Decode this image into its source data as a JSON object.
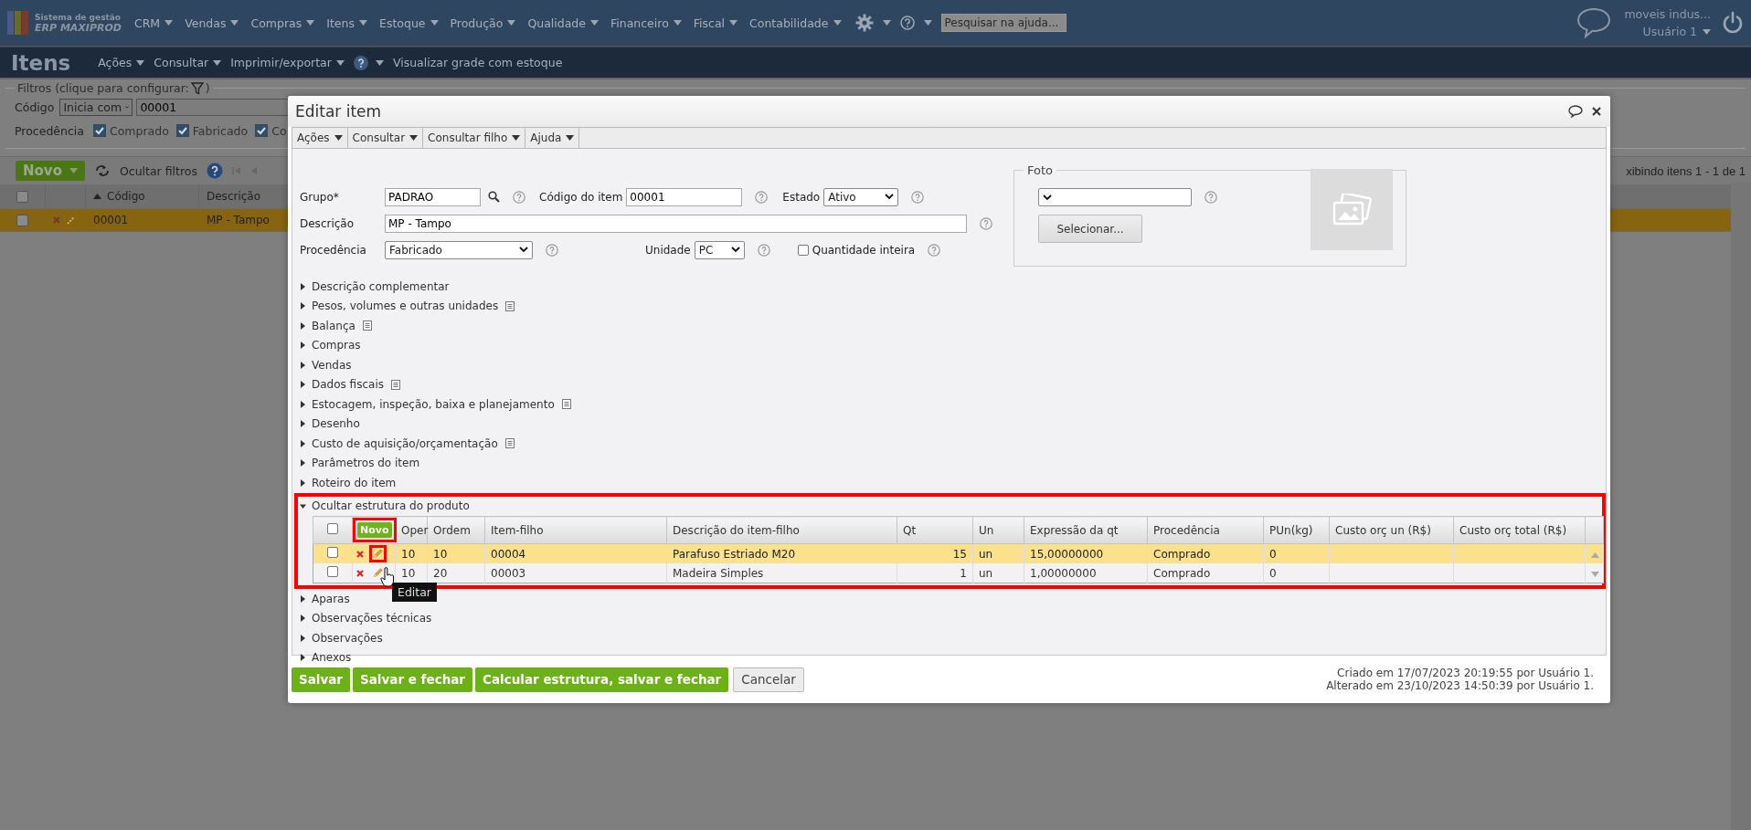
{
  "top_bar": {
    "brand": [
      "Sistema de gestão",
      "ERP MAXIPROD"
    ],
    "menu": [
      "CRM",
      "Vendas",
      "Compras",
      "Itens",
      "Estoque",
      "Produção",
      "Qualidade",
      "Financeiro",
      "Fiscal",
      "Contabilidade"
    ],
    "help_search": {
      "placeholder": "Pesquisar na ajuda..."
    },
    "account": {
      "company": "moveis indus...",
      "user": "Usuário 1"
    }
  },
  "page_header": {
    "title": "Itens",
    "menu": [
      "Ações",
      "Consultar",
      "Imprimir/exportar"
    ],
    "grid_link": "Visualizar grade com estoque"
  },
  "filters": {
    "legend": "Filtros (clique para configurar:",
    "legend_end": ")",
    "code": {
      "label": "Código",
      "operator": "Inicia com",
      "value": "00001"
    },
    "origin": {
      "label": "Procedência",
      "options": [
        {
          "label": "Comprado",
          "checked": true
        },
        {
          "label": "Fabricado",
          "checked": true
        },
        {
          "label": "Co",
          "checked": true
        }
      ]
    }
  },
  "list_toolbar": {
    "new_button": "Novo",
    "hide_filters": "Ocultar filtros",
    "paging": "xibindo itens 1 - 1 de 1"
  },
  "list": {
    "select_all_checked": false,
    "columns": [
      "Código",
      "Descrição"
    ],
    "rows": [
      {
        "code": "00001",
        "description": "MP - Tampo",
        "selected": true,
        "checked": false
      }
    ]
  },
  "dialog": {
    "title": "Editar item",
    "menu": [
      "Ações",
      "Consultar",
      "Consultar filho",
      "Ajuda"
    ],
    "fields": {
      "group": {
        "label": "Grupo*",
        "value": "PADRAO"
      },
      "code": {
        "label": "Código do item",
        "value": "00001"
      },
      "state": {
        "label": "Estado",
        "value": "Ativo"
      },
      "description": {
        "label": "Descrição",
        "value": "MP - Tampo"
      },
      "origin": {
        "label": "Procedência",
        "value": "Fabricado"
      },
      "unit": {
        "label": "Unidade",
        "value": "PC"
      },
      "whole_quantity": {
        "label": "Quantidade inteira",
        "checked": false
      }
    },
    "photo": {
      "legend": "Foto",
      "button": "Selecionar..."
    },
    "sections": [
      {
        "label": "Descrição complementar",
        "expanded": false,
        "note_icon": false
      },
      {
        "label": "Pesos, volumes e outras unidades",
        "expanded": false,
        "note_icon": true
      },
      {
        "label": "Balança",
        "expanded": false,
        "note_icon": true
      },
      {
        "label": "Compras",
        "expanded": false,
        "note_icon": false
      },
      {
        "label": "Vendas",
        "expanded": false,
        "note_icon": false
      },
      {
        "label": "Dados fiscais",
        "expanded": false,
        "note_icon": true
      },
      {
        "label": "Estocagem, inspeção, baixa e planejamento",
        "expanded": false,
        "note_icon": true
      },
      {
        "label": "Desenho",
        "expanded": false,
        "note_icon": false
      },
      {
        "label": "Custo de aquisição/orçamentação",
        "expanded": false,
        "note_icon": true
      },
      {
        "label": "Parâmetros do item",
        "expanded": false,
        "note_icon": false
      },
      {
        "label": "Roteiro do item",
        "expanded": false,
        "note_icon": false
      },
      {
        "label": "Ocultar estrutura do produto",
        "expanded": true,
        "note_icon": false
      },
      {
        "label": "Aparas",
        "expanded": false,
        "note_icon": false
      },
      {
        "label": "Observações técnicas",
        "expanded": false,
        "note_icon": false
      },
      {
        "label": "Observações",
        "expanded": false,
        "note_icon": false
      },
      {
        "label": "Anexos",
        "expanded": false,
        "note_icon": false
      }
    ],
    "structure": {
      "highlighted": true,
      "select_all_checked": false,
      "new_button": "Novo",
      "new_button_highlighted": true,
      "columns": [
        "Oper",
        "Ordem",
        "Item-filho",
        "Descrição do item-filho",
        "Qt",
        "Un",
        "Expressão da qt",
        "Procedência",
        "PUn(kg)",
        "Custo orç un (R$)",
        "Custo orç total (R$)"
      ],
      "rows": [
        {
          "selected": true,
          "checked": false,
          "pencil_highlighted": true,
          "cells": [
            "10",
            "10",
            "00004",
            "Parafuso Estriado M20",
            "15",
            "un",
            "15,00000000",
            "Comprado",
            "0"
          ]
        },
        {
          "selected": false,
          "checked": false,
          "pencil_highlighted": false,
          "cells": [
            "10",
            "20",
            "00003",
            "Madeira Simples",
            "1",
            "un",
            "1,00000000",
            "Comprado",
            "0"
          ]
        }
      ],
      "tooltip": "Editar"
    },
    "buttons": [
      {
        "label": "Salvar",
        "kind": "primary"
      },
      {
        "label": "Salvar e fechar",
        "kind": "primary"
      },
      {
        "label": "Calcular estrutura, salvar e fechar",
        "kind": "primary"
      },
      {
        "label": "Cancelar",
        "kind": "secondary"
      }
    ],
    "created": "Criado em 17/07/2023 20:19:55 por Usuário 1.",
    "altered": "Alterado em 23/10/2023 14:50:39 por Usuário 1."
  }
}
